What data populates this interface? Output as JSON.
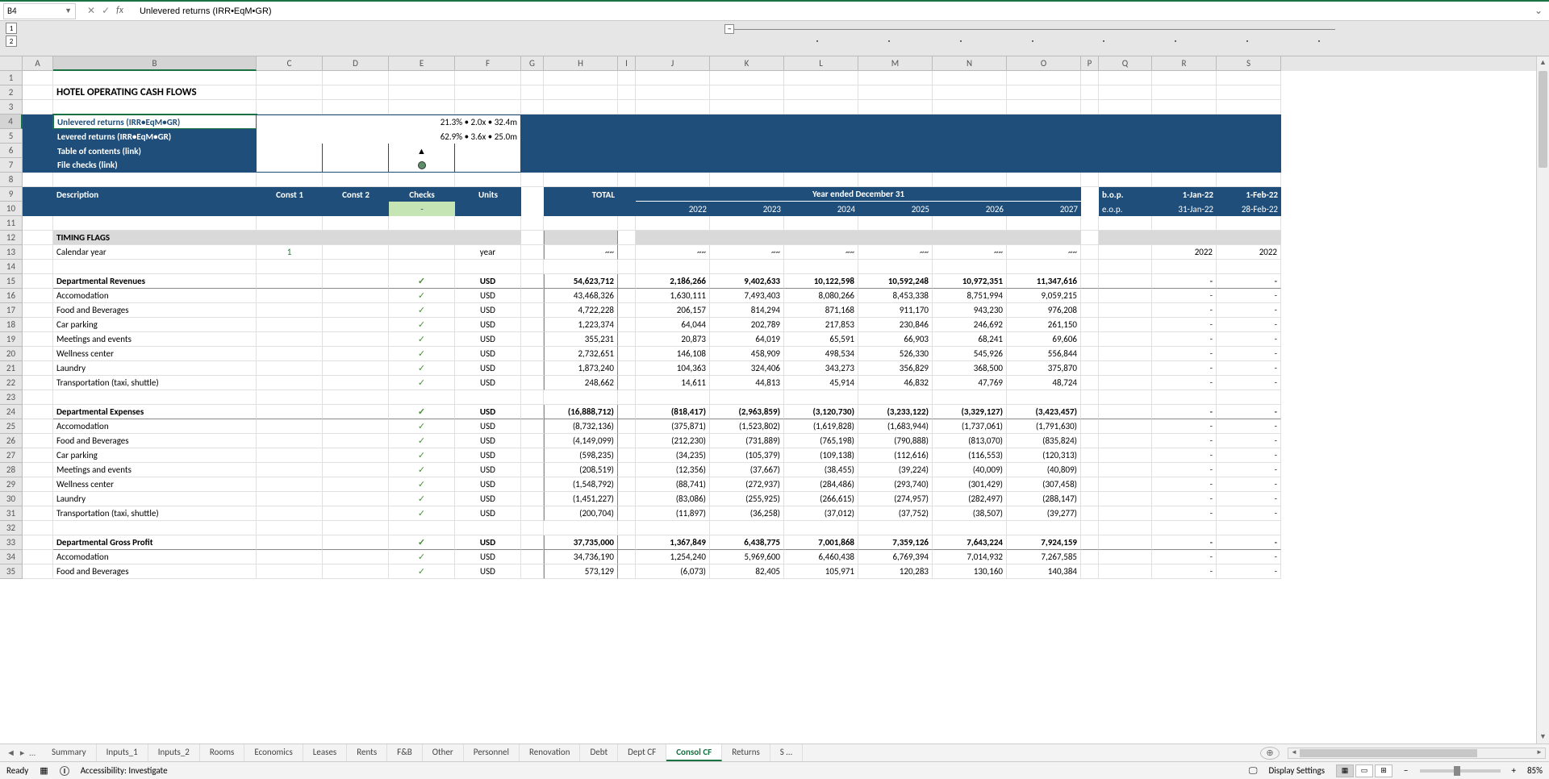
{
  "name_box": "B4",
  "formula": "Unlevered returns (IRR•EqM•GR)",
  "outline_levels": [
    "1",
    "2"
  ],
  "columns": [
    "A",
    "B",
    "C",
    "D",
    "E",
    "F",
    "G",
    "H",
    "I",
    "J",
    "K",
    "L",
    "M",
    "N",
    "O",
    "P",
    "Q",
    "R",
    "S"
  ],
  "title": "HOTEL OPERATING CASH FLOWS",
  "returns_box": {
    "r4": {
      "label": "Unlevered returns (IRR•EqM•GR)",
      "value": "21.3% • 2.0x • 32.4m"
    },
    "r5": {
      "label": "Levered returns (IRR•EqM•GR)",
      "value": "62.9% • 3.6x • 25.0m"
    },
    "r6": {
      "label": "Table of contents (link)",
      "symbol": "▲"
    },
    "r7": {
      "label": "File checks (link)",
      "symbol": "●"
    }
  },
  "header": {
    "description": "Description",
    "const1": "Const 1",
    "const2": "Const 2",
    "checks": "Checks",
    "units": "Units",
    "total": "TOTAL",
    "year_band": "Year ended December 31",
    "years": [
      "2022",
      "2023",
      "2024",
      "2025",
      "2026",
      "2027"
    ],
    "bop": "b.o.p.",
    "eop": "e.o.p.",
    "bop_dates": [
      "1-Jan-22",
      "1-Feb-22"
    ],
    "eop_dates": [
      "31-Jan-22",
      "28-Feb-22"
    ],
    "checks_dash": "-"
  },
  "sections": {
    "timing": {
      "title": "TIMING FLAGS",
      "rows": [
        {
          "label": "Calendar year",
          "const1": "1",
          "units": "year",
          "total": "~~",
          "vals": [
            "~~",
            "~~",
            "~~",
            "~~",
            "~~",
            "~~"
          ],
          "r": "2022",
          "s": "2022"
        }
      ]
    },
    "dept_rev": {
      "title": "Departmental Revenues",
      "units": "USD",
      "total": "54,623,712",
      "vals": [
        "2,186,266",
        "9,402,633",
        "10,122,598",
        "10,592,248",
        "10,972,351",
        "11,347,616"
      ],
      "rows": [
        {
          "label": "Accomodation",
          "units": "USD",
          "total": "43,468,326",
          "vals": [
            "1,630,111",
            "7,493,403",
            "8,080,266",
            "8,453,338",
            "8,751,994",
            "9,059,215"
          ]
        },
        {
          "label": "Food and Beverages",
          "units": "USD",
          "total": "4,722,228",
          "vals": [
            "206,157",
            "814,294",
            "871,168",
            "911,170",
            "943,230",
            "976,208"
          ]
        },
        {
          "label": "Car parking",
          "units": "USD",
          "total": "1,223,374",
          "vals": [
            "64,044",
            "202,789",
            "217,853",
            "230,846",
            "246,692",
            "261,150"
          ]
        },
        {
          "label": "Meetings and events",
          "units": "USD",
          "total": "355,231",
          "vals": [
            "20,873",
            "64,019",
            "65,591",
            "66,903",
            "68,241",
            "69,606"
          ]
        },
        {
          "label": "Wellness center",
          "units": "USD",
          "total": "2,732,651",
          "vals": [
            "146,108",
            "458,909",
            "498,534",
            "526,330",
            "545,926",
            "556,844"
          ]
        },
        {
          "label": "Laundry",
          "units": "USD",
          "total": "1,873,240",
          "vals": [
            "104,363",
            "324,406",
            "343,273",
            "356,829",
            "368,500",
            "375,870"
          ]
        },
        {
          "label": "Transportation (taxi, shuttle)",
          "units": "USD",
          "total": "248,662",
          "vals": [
            "14,611",
            "44,813",
            "45,914",
            "46,832",
            "47,769",
            "48,724"
          ]
        }
      ]
    },
    "dept_exp": {
      "title": "Departmental Expenses",
      "units": "USD",
      "total": "(16,888,712)",
      "vals": [
        "(818,417)",
        "(2,963,859)",
        "(3,120,730)",
        "(3,233,122)",
        "(3,329,127)",
        "(3,423,457)"
      ],
      "rows": [
        {
          "label": "Accomodation",
          "units": "USD",
          "total": "(8,732,136)",
          "vals": [
            "(375,871)",
            "(1,523,802)",
            "(1,619,828)",
            "(1,683,944)",
            "(1,737,061)",
            "(1,791,630)"
          ]
        },
        {
          "label": "Food and Beverages",
          "units": "USD",
          "total": "(4,149,099)",
          "vals": [
            "(212,230)",
            "(731,889)",
            "(765,198)",
            "(790,888)",
            "(813,070)",
            "(835,824)"
          ]
        },
        {
          "label": "Car parking",
          "units": "USD",
          "total": "(598,235)",
          "vals": [
            "(34,235)",
            "(105,379)",
            "(109,138)",
            "(112,616)",
            "(116,553)",
            "(120,313)"
          ]
        },
        {
          "label": "Meetings and events",
          "units": "USD",
          "total": "(208,519)",
          "vals": [
            "(12,356)",
            "(37,667)",
            "(38,455)",
            "(39,224)",
            "(40,009)",
            "(40,809)"
          ]
        },
        {
          "label": "Wellness center",
          "units": "USD",
          "total": "(1,548,792)",
          "vals": [
            "(88,741)",
            "(272,937)",
            "(284,486)",
            "(293,740)",
            "(301,429)",
            "(307,458)"
          ]
        },
        {
          "label": "Laundry",
          "units": "USD",
          "total": "(1,451,227)",
          "vals": [
            "(83,086)",
            "(255,925)",
            "(266,615)",
            "(274,957)",
            "(282,497)",
            "(288,147)"
          ]
        },
        {
          "label": "Transportation (taxi, shuttle)",
          "units": "USD",
          "total": "(200,704)",
          "vals": [
            "(11,897)",
            "(36,258)",
            "(37,012)",
            "(37,752)",
            "(38,507)",
            "(39,277)"
          ]
        }
      ]
    },
    "dept_gp": {
      "title": "Departmental Gross Profit",
      "units": "USD",
      "total": "37,735,000",
      "vals": [
        "1,367,849",
        "6,438,775",
        "7,001,868",
        "7,359,126",
        "7,643,224",
        "7,924,159"
      ],
      "rows": [
        {
          "label": "Accomodation",
          "units": "USD",
          "total": "34,736,190",
          "vals": [
            "1,254,240",
            "5,969,600",
            "6,460,438",
            "6,769,394",
            "7,014,932",
            "7,267,585"
          ]
        },
        {
          "label": "Food and Beverages",
          "units": "USD",
          "total": "573,129",
          "vals": [
            "(6,073)",
            "82,405",
            "105,971",
            "120,283",
            "130,160",
            "140,384"
          ]
        }
      ]
    }
  },
  "tick": "✓",
  "dash": "-",
  "tabs": [
    "Summary",
    "Inputs_1",
    "Inputs_2",
    "Rooms",
    "Economics",
    "Leases",
    "Rents",
    "F&B",
    "Other",
    "Personnel",
    "Renovation",
    "Debt",
    "Dept CF",
    "Consol CF",
    "Returns",
    "S …"
  ],
  "active_tab": "Consol CF",
  "tab_ellipsis": "…",
  "status": {
    "ready": "Ready",
    "accessibility": "Accessibility: Investigate",
    "display": "Display Settings",
    "zoom": "85%"
  }
}
